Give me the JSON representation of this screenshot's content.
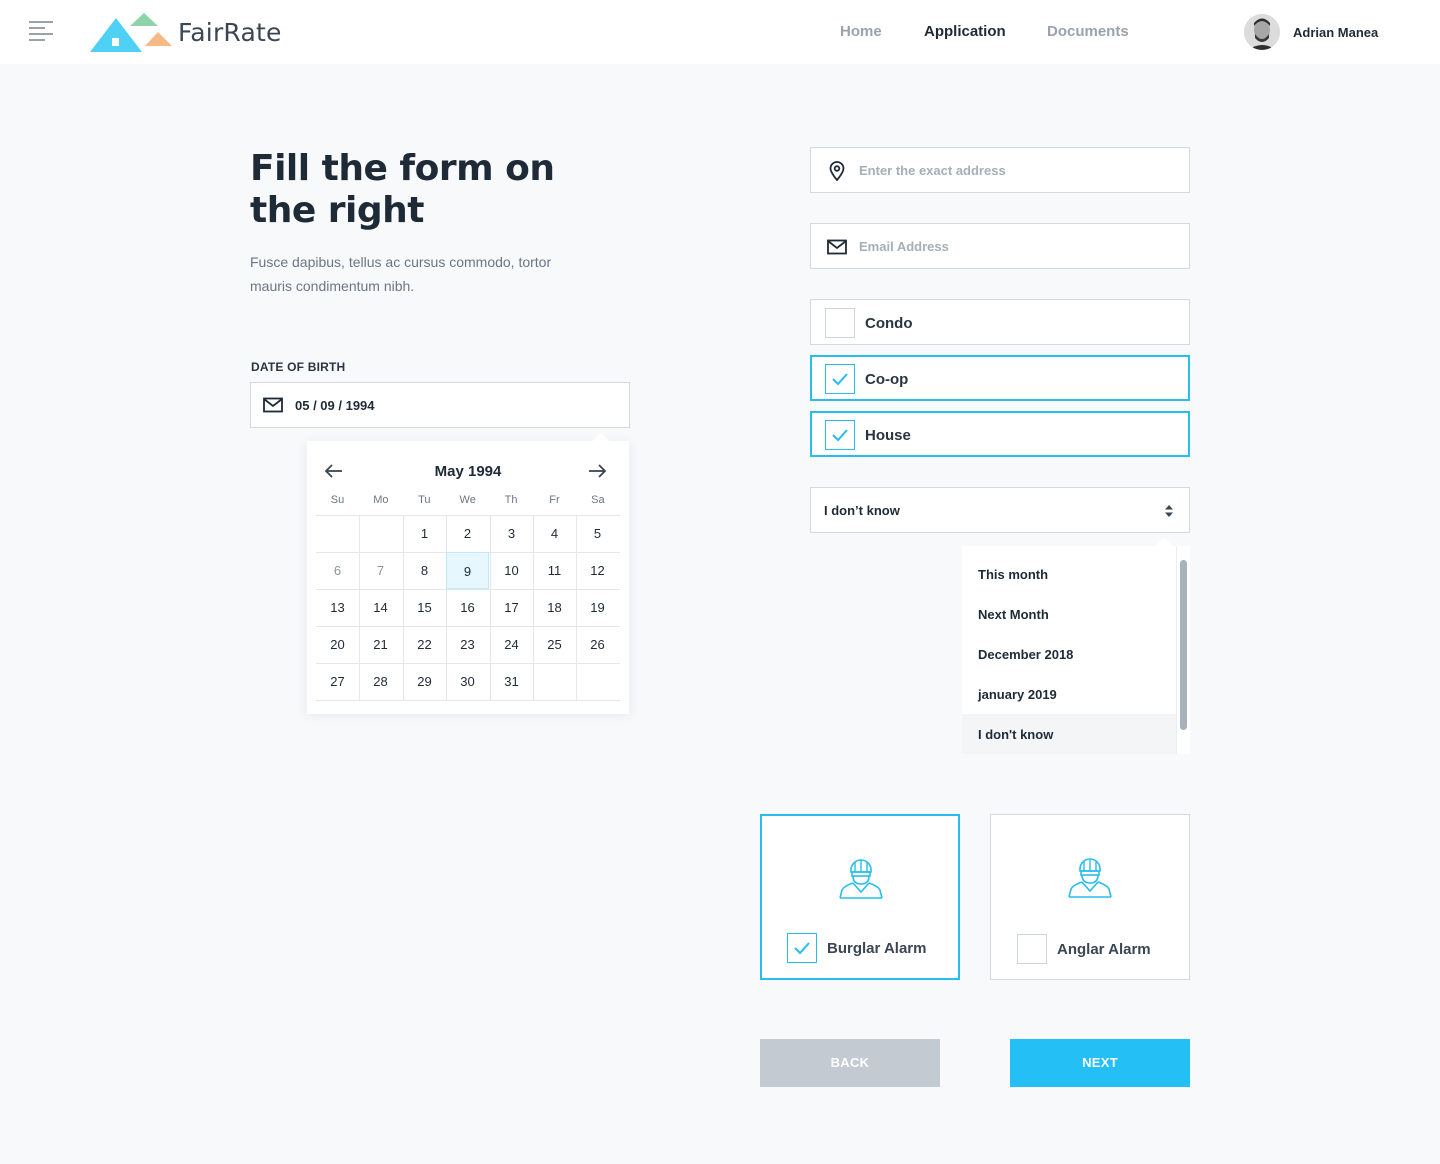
{
  "header": {
    "brand": "FairRate",
    "nav": [
      {
        "label": "Home",
        "active": false
      },
      {
        "label": "Application",
        "active": true
      },
      {
        "label": "Documents",
        "active": false
      }
    ],
    "user": {
      "name": "Adrian Manea",
      "avatar_icon": "user-avatar-icon"
    }
  },
  "intro": {
    "title": "Fill the form on the right",
    "subtitle": "Fusce dapibus, tellus ac cursus commodo, tortor mauris condimentum nibh."
  },
  "dob": {
    "label": "DATE OF BIRTH",
    "value": "05 / 09 / 1994",
    "icon": "mail-icon"
  },
  "calendar": {
    "month_label": "May 1994",
    "weekdays": [
      "Su",
      "Mo",
      "Tu",
      "We",
      "Th",
      "Fr",
      "Sa"
    ],
    "weeks": [
      [
        "",
        "",
        "1",
        "2",
        "3",
        "4",
        "5"
      ],
      [
        "6",
        "7",
        "8",
        "9",
        "10",
        "11",
        "12"
      ],
      [
        "13",
        "14",
        "15",
        "16",
        "17",
        "18",
        "19"
      ],
      [
        "20",
        "21",
        "22",
        "23",
        "24",
        "25",
        "26"
      ],
      [
        "27",
        "28",
        "29",
        "30",
        "31",
        "",
        ""
      ]
    ],
    "selected_day": "9"
  },
  "form": {
    "address": {
      "placeholder": "Enter the exact address",
      "icon": "map-pin-icon"
    },
    "email": {
      "placeholder": "Email Address",
      "icon": "mail-icon"
    },
    "property_types": [
      {
        "label": "Condo",
        "checked": false
      },
      {
        "label": "Co-op",
        "checked": true
      },
      {
        "label": "House",
        "checked": true
      }
    ],
    "timing_select": {
      "value": "I don’t know",
      "options": [
        "This month",
        "Next Month",
        "December 2018",
        "january 2019",
        "I don't know"
      ],
      "highlighted": "I don't know"
    },
    "alarms": [
      {
        "label": "Burglar Alarm",
        "checked": true,
        "icon": "burglar-icon"
      },
      {
        "label": "Anglar Alarm",
        "checked": false,
        "icon": "burglar-icon"
      }
    ]
  },
  "actions": {
    "back": "BACK",
    "next": "NEXT"
  },
  "colors": {
    "accent": "#23bff5",
    "text": "#1f2a37",
    "muted": "#9aa3ad",
    "back_button": "#c3cad2"
  }
}
